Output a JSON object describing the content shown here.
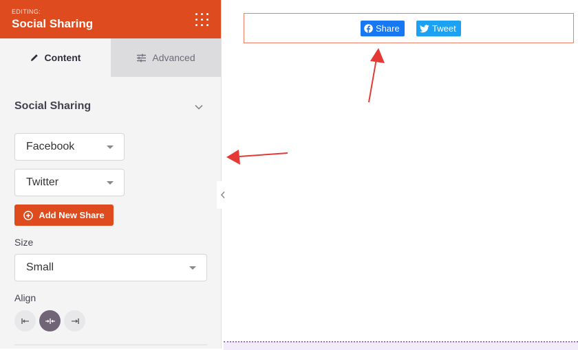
{
  "header": {
    "editing_label": "EDITING:",
    "title": "Social Sharing",
    "menu_icon": "grid-dots-icon"
  },
  "tabs": [
    {
      "label": "Content",
      "icon": "pencil-icon",
      "active": true
    },
    {
      "label": "Advanced",
      "icon": "sliders-icon",
      "active": false
    }
  ],
  "section": {
    "title": "Social Sharing",
    "icon": "chevron-down-icon"
  },
  "shares": [
    {
      "value": "Facebook"
    },
    {
      "value": "Twitter"
    }
  ],
  "add_button": {
    "label": "Add New Share",
    "icon": "plus-circle-icon"
  },
  "size": {
    "label": "Size",
    "value": "Small"
  },
  "align": {
    "label": "Align",
    "options": [
      "align-left-icon",
      "align-center-icon",
      "align-right-icon"
    ],
    "selected": "align-center-icon"
  },
  "preview": {
    "facebook_label": "Share",
    "twitter_label": "Tweet"
  },
  "colors": {
    "brand": "#dd4b1f",
    "facebook": "#1877f2",
    "twitter": "#1da1f2",
    "annotation_arrow": "#e53935"
  }
}
